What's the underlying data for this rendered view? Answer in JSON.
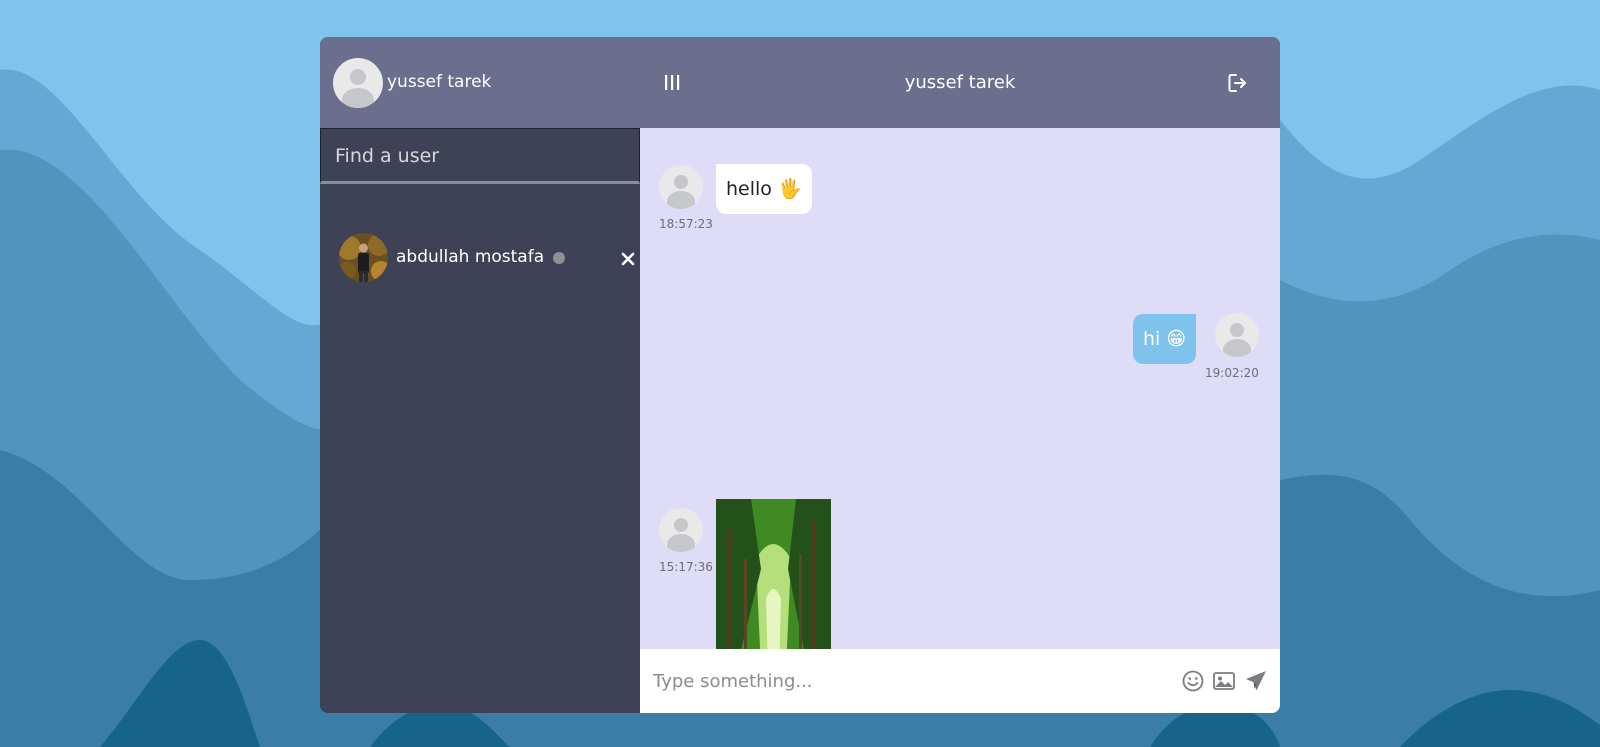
{
  "header": {
    "current_user_name": "yussef tarek",
    "chat_partner_name": "yussef tarek",
    "menu_icon": "menu-bars-icon",
    "logout_icon": "logout-icon"
  },
  "sidebar": {
    "search": {
      "placeholder": "Find a user"
    },
    "contacts": [
      {
        "name": "abdullah mostafa",
        "status": "offline"
      }
    ]
  },
  "messages": [
    {
      "direction": "incoming",
      "type": "text",
      "text": "hello 🖐",
      "time": "18:57:23"
    },
    {
      "direction": "outgoing",
      "type": "text",
      "text": "hi 😁",
      "time": "19:02:20"
    },
    {
      "direction": "incoming",
      "type": "image",
      "description": "forest path photo",
      "time": "15:17:36"
    }
  ],
  "composer": {
    "placeholder": "Type something...",
    "icons": [
      "emoji-icon",
      "image-icon",
      "send-icon"
    ]
  },
  "colors": {
    "header": "#6b6f8d",
    "sidebar": "#3f4257",
    "chat_background": "#dedcf7",
    "outgoing_bubble": "#7fc2ec",
    "incoming_bubble": "#ffffff"
  }
}
